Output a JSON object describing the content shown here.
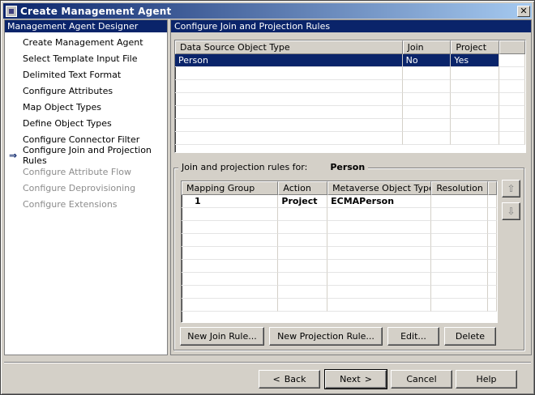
{
  "window": {
    "title": "Create Management Agent"
  },
  "left_panel": {
    "header": "Management Agent Designer",
    "steps": [
      {
        "label": "Create Management Agent",
        "state": "done"
      },
      {
        "label": "Select Template Input File",
        "state": "done"
      },
      {
        "label": "Delimited Text Format",
        "state": "done"
      },
      {
        "label": "Configure Attributes",
        "state": "done"
      },
      {
        "label": "Map Object Types",
        "state": "done"
      },
      {
        "label": "Define Object Types",
        "state": "done"
      },
      {
        "label": "Configure Connector Filter",
        "state": "done"
      },
      {
        "label": "Configure Join and Projection Rules",
        "state": "current"
      },
      {
        "label": "Configure Attribute Flow",
        "state": "disabled"
      },
      {
        "label": "Configure Deprovisioning",
        "state": "disabled"
      },
      {
        "label": "Configure Extensions",
        "state": "disabled"
      }
    ]
  },
  "right_panel": {
    "header": "Configure Join and Projection Rules",
    "object_table": {
      "columns": [
        "Data Source Object Type",
        "Join",
        "Project"
      ],
      "rows": [
        {
          "type": "Person",
          "join": "No",
          "project": "Yes"
        }
      ]
    },
    "rules_group": {
      "label": "Join and projection rules for:",
      "object": "Person",
      "columns": [
        "Mapping Group",
        "Action",
        "Metaverse Object Type",
        "Resolution"
      ],
      "rows": [
        {
          "group": "1",
          "action": "Project",
          "mv_type": "ECMAPerson",
          "resolution": ""
        }
      ],
      "buttons": {
        "new_join": "New Join Rule...",
        "new_projection": "New Projection Rule...",
        "edit": "Edit...",
        "delete": "Delete"
      },
      "up_icon": "arrow-up-icon",
      "down_icon": "arrow-down-icon"
    }
  },
  "footer": {
    "back": "Back",
    "next": "Next",
    "cancel": "Cancel",
    "help": "Help"
  }
}
